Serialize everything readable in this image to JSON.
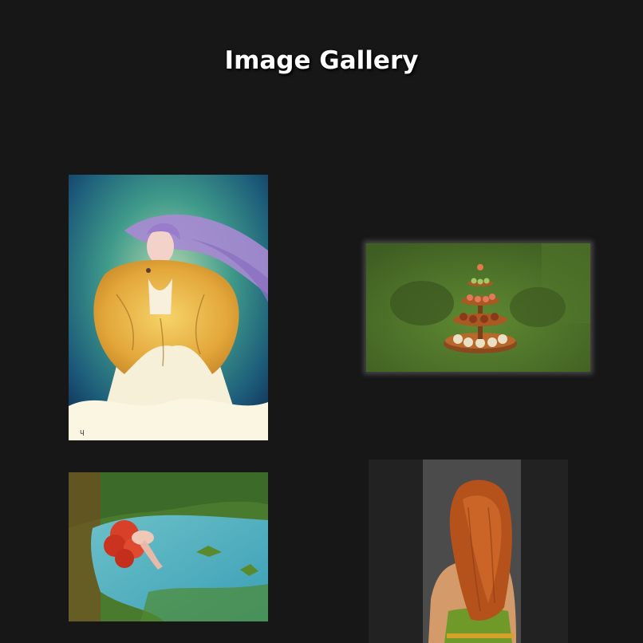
{
  "header": {
    "title": "Image Gallery"
  },
  "gallery": {
    "items": [
      {
        "subject": "painting-woman-lavender-hair-golden-fur-stole",
        "icon": "image-icon"
      },
      {
        "subject": "render-tiered-cupcake-stand-green-room",
        "icon": "image-icon"
      },
      {
        "subject": "painting-red-haired-mermaid-in-pond",
        "icon": "image-icon"
      },
      {
        "subject": "render-auburn-haired-woman-back-view",
        "icon": "image-icon"
      }
    ]
  },
  "colors": {
    "background": "#171717",
    "title_text": "#ffffff"
  }
}
